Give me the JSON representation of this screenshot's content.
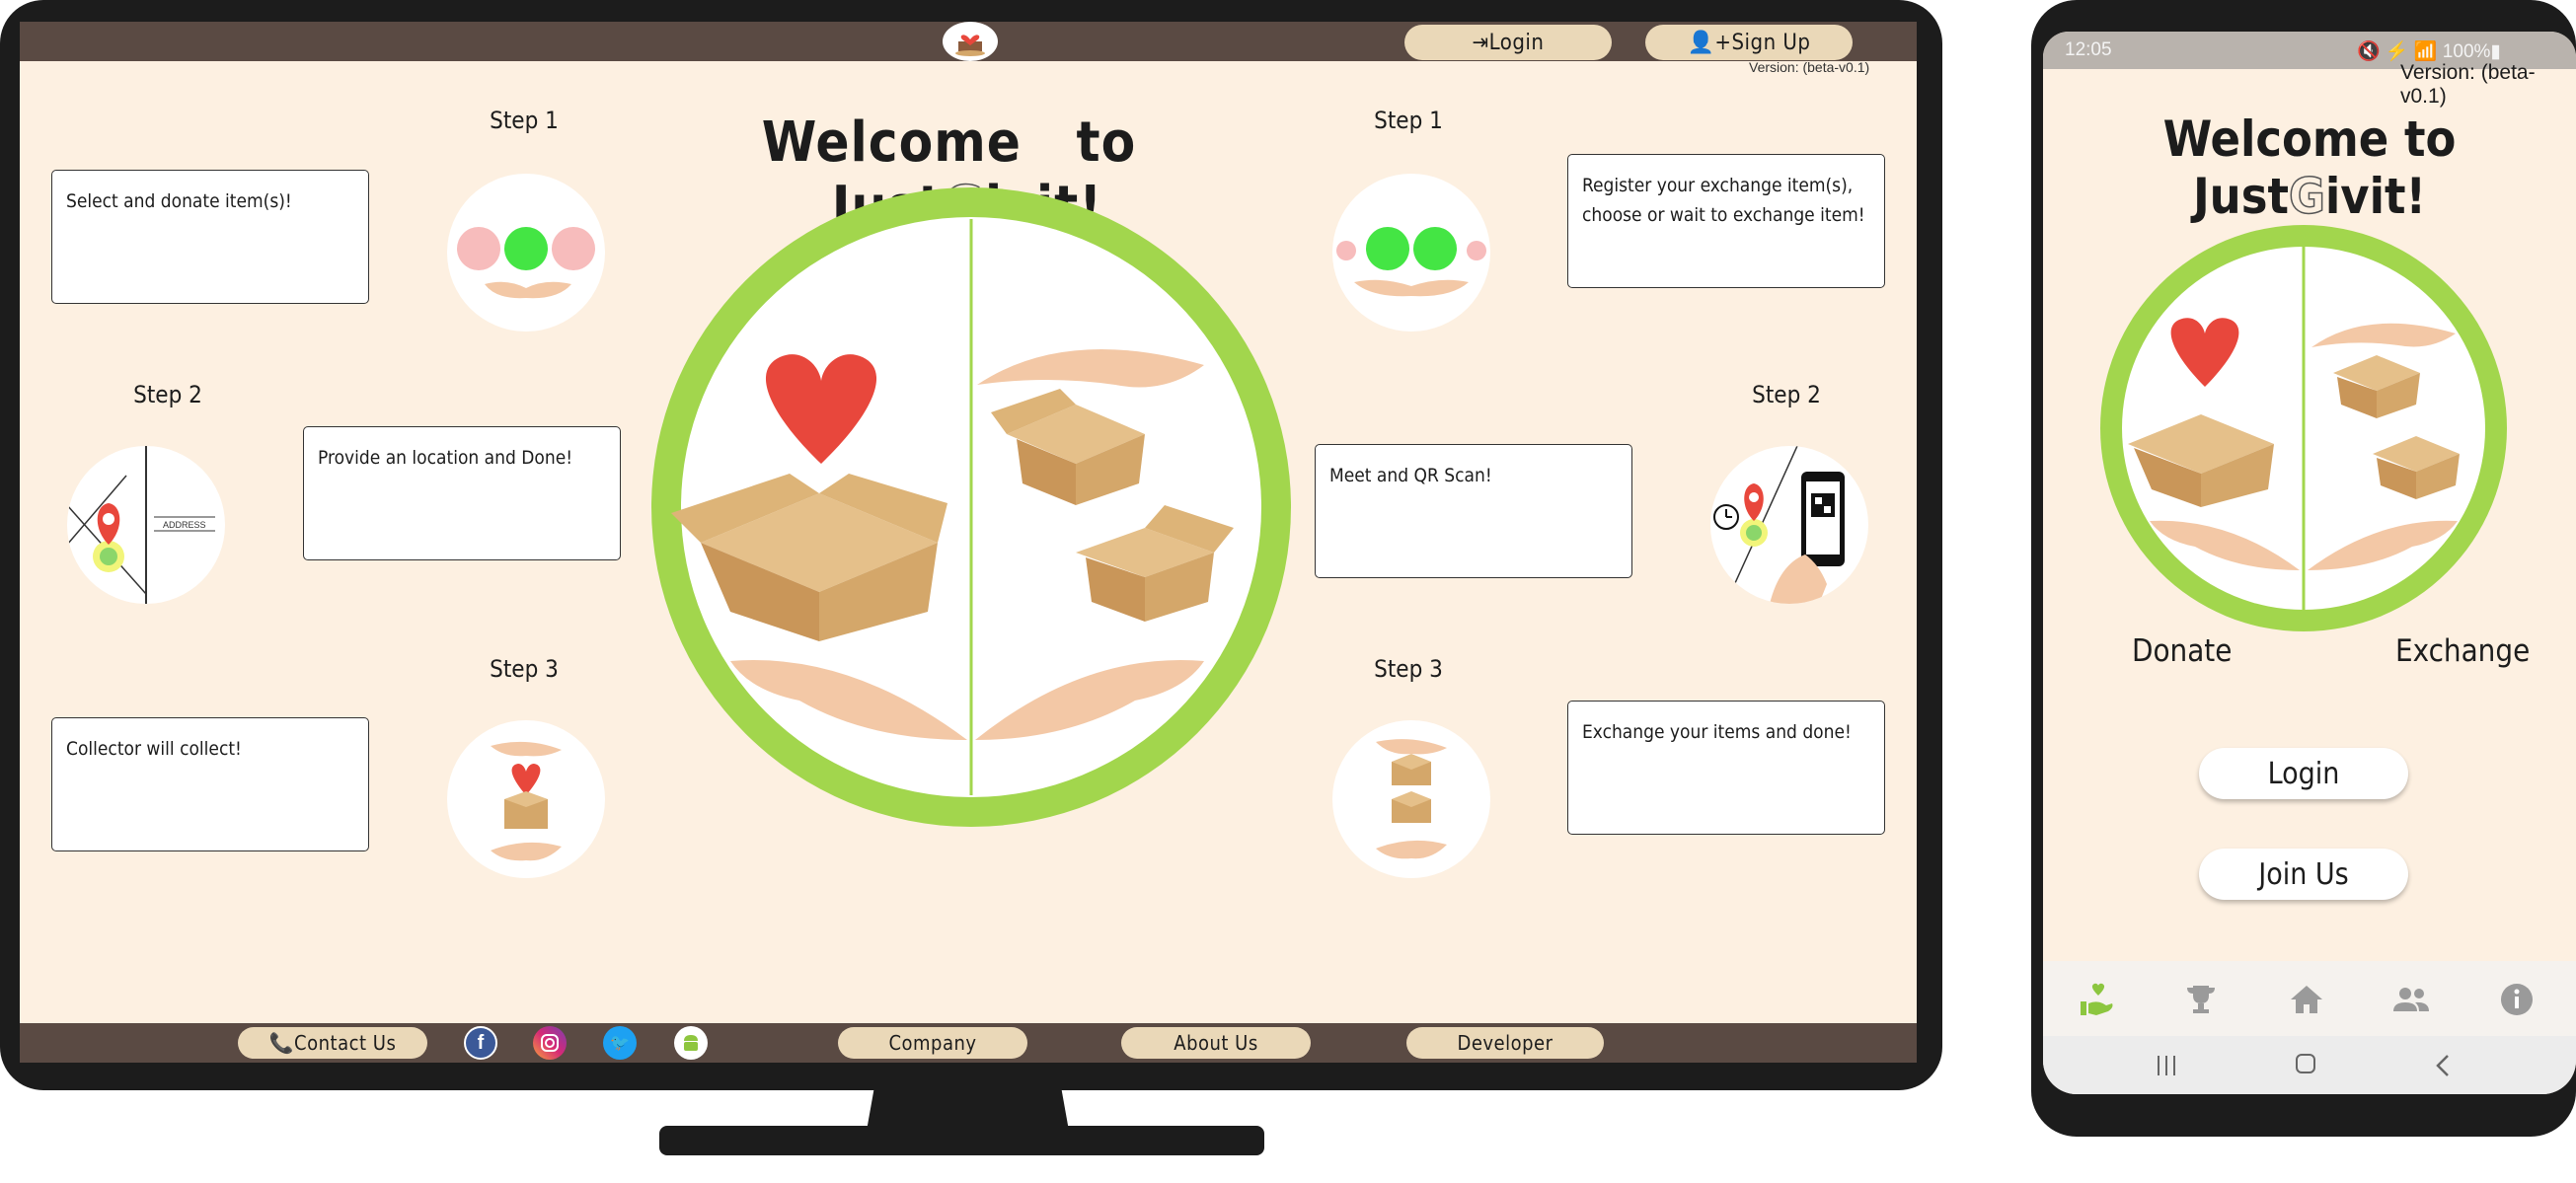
{
  "desktop": {
    "header": {
      "login_label": "⇥Login",
      "signup_label": "👤+Sign Up",
      "version": "Version: (beta-v0.1)"
    },
    "title": {
      "part1": "Welcome",
      "part2": "to",
      "part3": "Just",
      "part4": "G",
      "part5": "ivit!"
    },
    "donate_steps": [
      {
        "label": "Step 1",
        "text": "Select and donate item(s)!"
      },
      {
        "label": "Step 2",
        "text": "Provide an location and Done!"
      },
      {
        "label": "Step 3",
        "text": "Collector will collect!"
      }
    ],
    "exchange_steps": [
      {
        "label": "Step 1",
        "text": "Register your exchange item(s), choose or wait to exchange item!"
      },
      {
        "label": "Step 2",
        "text": "Meet and QR Scan!"
      },
      {
        "label": "Step 3",
        "text": "Exchange your items and done!"
      }
    ],
    "address_label": "ADDRESS",
    "footer": {
      "contact_label": "📞Contact Us",
      "company_label": "Company",
      "about_label": "About Us",
      "developer_label": "Developer",
      "facebook": "f",
      "twitter": "🐦"
    }
  },
  "phone": {
    "status_time": "12:05",
    "status_right": "🔇 ⚡ 📶 100%▮",
    "version": "Version: (beta-v0.1)",
    "title": {
      "part1": "Welcome to Just",
      "part2": "G",
      "part3": "ivit!"
    },
    "donate_label": "Donate",
    "exchange_label": "Exchange",
    "login_label": "Login",
    "join_label": "Join Us",
    "nav_items": [
      "donate-hand-icon",
      "trophy-icon",
      "home-icon",
      "people-icon",
      "info-icon"
    ],
    "sys_nav": [
      "recent-apps-icon",
      "home-circle-icon",
      "back-icon"
    ]
  },
  "colors": {
    "cream": "#fdf0e1",
    "bar": "#5a4a43",
    "pill": "#ead8b8",
    "green": "#a2d64d",
    "heart": "#e8473c",
    "box": "#d4a76a"
  }
}
